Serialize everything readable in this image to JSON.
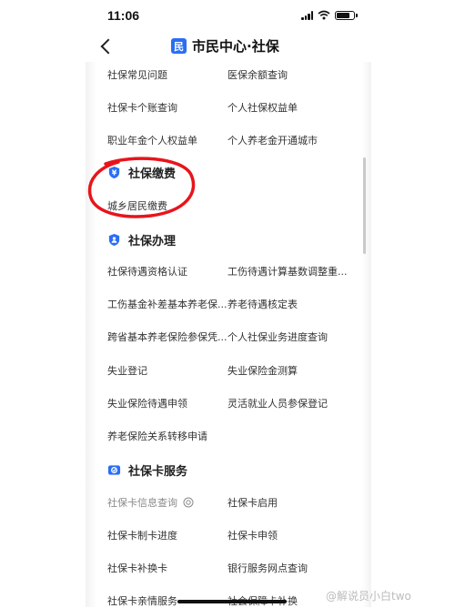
{
  "status": {
    "time": "11:06"
  },
  "nav": {
    "logo_char": "民",
    "title": "市民中心·社保"
  },
  "rows_top": [
    {
      "left": "社保常见问题",
      "right": "医保余额查询"
    },
    {
      "left": "社保卡个账查询",
      "right": "个人社保权益单"
    },
    {
      "left": "职业年金个人权益单",
      "right": "个人养老金开通城市"
    }
  ],
  "sec_payment": {
    "title": "社保缴费",
    "items": [
      "城乡居民缴费"
    ]
  },
  "sec_handling": {
    "title": "社保办理",
    "rows": [
      {
        "left": "社保待遇资格认证",
        "right": "工伤待遇计算基数调整重..."
      },
      {
        "left": "工伤基金补差基本养老保...",
        "right": "养老待遇核定表"
      },
      {
        "left": "跨省基本养老保险参保凭...",
        "right": "个人社保业务进度查询"
      },
      {
        "left": "失业登记",
        "right": "失业保险金测算"
      },
      {
        "left": "失业保险待遇申领",
        "right": "灵活就业人员参保登记"
      },
      {
        "left": "养老保险关系转移申请",
        "right": ""
      }
    ]
  },
  "sec_card": {
    "title": "社保卡服务",
    "rows": [
      {
        "left": "社保卡信息查询",
        "right": "社保卡启用"
      },
      {
        "left": "社保卡制卡进度",
        "right": "社保卡申领"
      },
      {
        "left": "社保卡补换卡",
        "right": "银行服务网点查询"
      },
      {
        "left": "社保卡亲情服务",
        "right": "社会保障卡补换"
      }
    ]
  },
  "watermark": "@解说员小白two",
  "colors": {
    "accent": "#2a6ef5",
    "highlight_circle": "#e8141b"
  }
}
